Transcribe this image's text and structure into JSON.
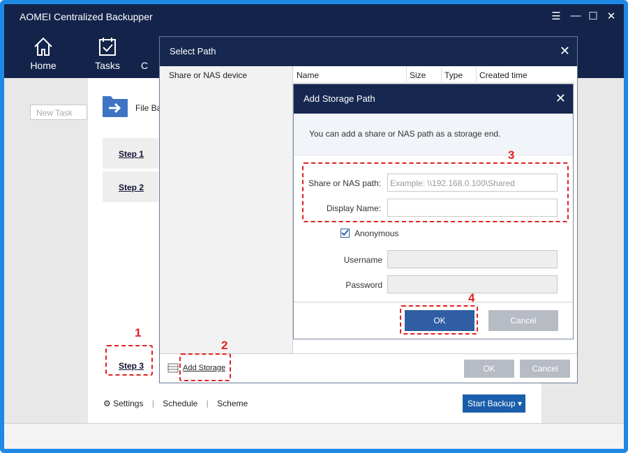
{
  "app": {
    "title": "AOMEI Centralized Backupper"
  },
  "window_controls": {
    "menu_icon": "menu-icon",
    "minimize_icon": "minimize-icon",
    "maximize_icon": "maximize-icon",
    "close_icon": "close-icon"
  },
  "nav": [
    {
      "label": "Home",
      "icon": "home-icon"
    },
    {
      "label": "Tasks",
      "icon": "tasks-icon"
    },
    {
      "label": "C",
      "icon": ""
    }
  ],
  "sidebar": {
    "new_task_placeholder": "New Task"
  },
  "main": {
    "file_label": "File Ba",
    "steps": [
      "Step 1",
      "Step 2",
      "Step 3"
    ],
    "bottom_links": [
      "Settings",
      "Schedule",
      "Scheme"
    ],
    "start_backup": "Start Backup"
  },
  "select_path": {
    "title": "Select Path",
    "tree_item": "Share or NAS device",
    "columns": [
      "Name",
      "Size",
      "Type",
      "Created time"
    ],
    "add_storage": "Add Storage",
    "ok": "OK",
    "cancel": "Cancel"
  },
  "add_storage": {
    "title": "Add Storage Path",
    "info": "You can add a share or NAS path as a storage end.",
    "share_label": "Share or NAS path:",
    "share_placeholder": "Example: \\\\192.168.0.100\\Shared",
    "display_label": "Display Name:",
    "anonymous_label": "Anonymous",
    "anonymous_checked": true,
    "username_label": "Username",
    "password_label": "Password",
    "ok": "OK",
    "cancel": "Cancel"
  },
  "annotations": [
    "1",
    "2",
    "3",
    "4"
  ],
  "colors": {
    "title_bar": "#13234a",
    "accent": "#2f5ea4",
    "annotation": "#e02020",
    "frame": "#1e88e5"
  }
}
